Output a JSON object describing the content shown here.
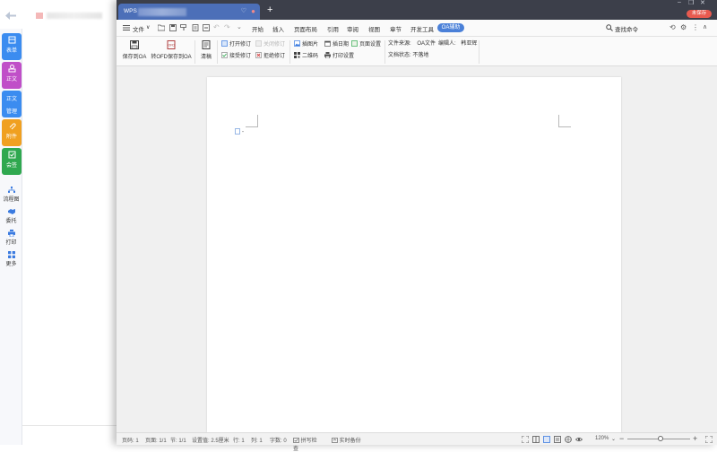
{
  "window": {
    "tab_title": "WPS",
    "new_tab": "+",
    "badge": "未保存"
  },
  "menubar": {
    "file": "文件",
    "items": [
      "开始",
      "插入",
      "页面布局",
      "引用",
      "审阅",
      "视图",
      "章节",
      "开发工具"
    ],
    "oa_tab": "OA辅助",
    "search": "查找命令"
  },
  "ribbon": {
    "save_to_oa": "保存到OA",
    "save_ofd": "转OFD保存到OA",
    "clear_draft": "清稿",
    "open_revision": "打开修订",
    "close_revision": "关闭修订",
    "accept_revision": "接受修订",
    "reject_revision": "拒绝修订",
    "insert_image": "插图片",
    "insert_date": "插日期",
    "page_setup": "页面设置",
    "qr_code": "二维码",
    "print_setup": "打印设置",
    "file_source_label": "文件来源:",
    "file_source_value": "OA文件",
    "editor_label": "编辑人:",
    "editor_value": "韩亚辉",
    "doc_status_label": "文档状态:",
    "doc_status_value": "不落地"
  },
  "left_rail": {
    "form": "表单",
    "text": "正文",
    "text_manage_1": "正文",
    "text_manage_2": "管理",
    "attachment": "附件",
    "sign": "会签",
    "flowchart": "流程图",
    "delegate": "委托",
    "print": "打印",
    "more": "更多"
  },
  "statusbar": {
    "page": "页码: 1",
    "pages": "页面: 1/1",
    "section": "节: 1/1",
    "setting": "设置值: 2.5厘米",
    "row": "行: 1",
    "col": "列: 1",
    "words": "字数: 0",
    "spell": "拼写检查",
    "backup": "实时备份",
    "zoom": "120%",
    "zoom_minus": "−",
    "zoom_plus": "+"
  },
  "colors": {
    "accent": "#4a80d8",
    "titlebar": "#3c3f4a",
    "badge": "#e85a4f"
  }
}
